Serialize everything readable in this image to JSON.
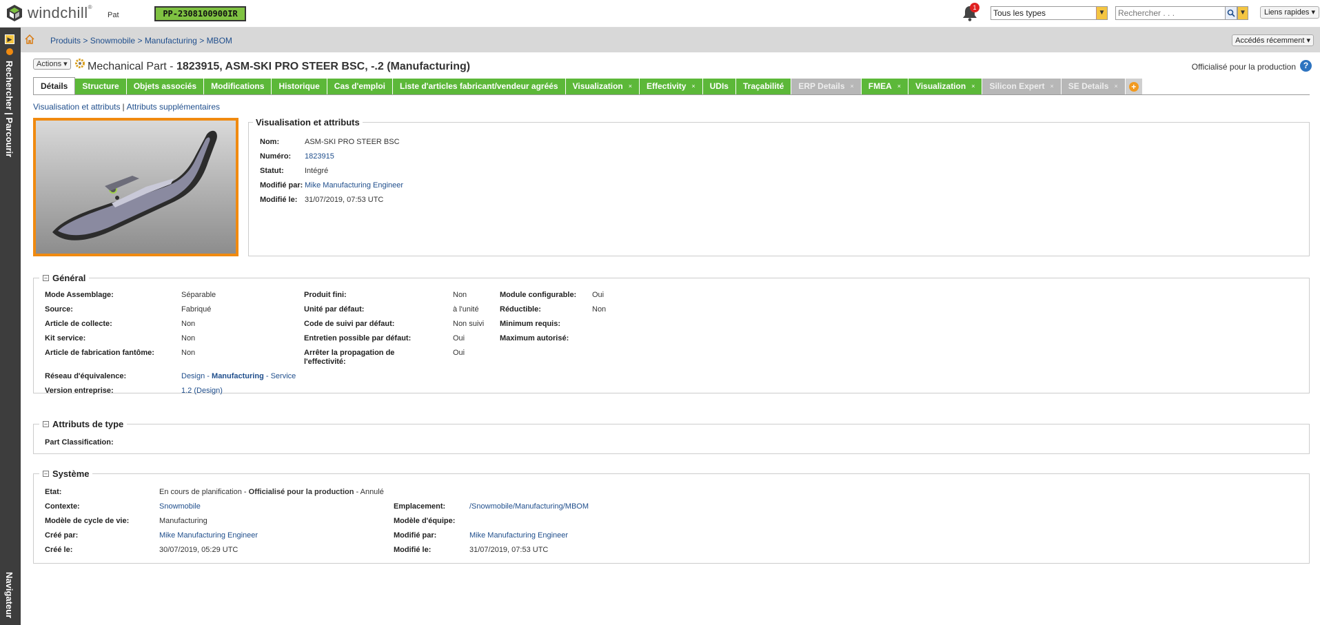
{
  "header": {
    "brand": "windchill",
    "brand_mark": "®",
    "user": "Pat",
    "badge": "PP-2308100900IR",
    "notification_count": "1",
    "type_select": {
      "value": "Tous les types"
    },
    "search": {
      "placeholder": "Rechercher . . ."
    },
    "quick_links": "Liens rapides"
  },
  "leftbar": {
    "search_browse": "Rechercher | Parcourir",
    "navigator": "Navigateur"
  },
  "breadcrumb": {
    "items": [
      "Produits",
      "Snowmobile",
      "Manufacturing",
      "MBOM"
    ],
    "separator": ">"
  },
  "recent": "Accédés récemment",
  "page": {
    "actions_label": "Actions",
    "title_type": "Mechanical Part - ",
    "title_main": "1823915, ASM-SKI PRO STEER BSC, -.2 (Manufacturing)",
    "status_text": "Officialisé pour la production",
    "help": "?"
  },
  "tabs": [
    {
      "label": "Détails"
    },
    {
      "label": "Structure"
    },
    {
      "label": "Objets associés"
    },
    {
      "label": "Modifications"
    },
    {
      "label": "Historique"
    },
    {
      "label": "Cas d'emploi"
    },
    {
      "label": "Liste d'articles fabricant/vendeur agréés"
    },
    {
      "label": "Visualization",
      "close": "×"
    },
    {
      "label": "Effectivity",
      "close": "×"
    },
    {
      "label": "UDIs"
    },
    {
      "label": "Traçabilité"
    },
    {
      "label": "ERP Details",
      "close": "×"
    },
    {
      "label": "FMEA",
      "close": "×"
    },
    {
      "label": "Visualization",
      "close": "×"
    },
    {
      "label": "Silicon Expert",
      "close": "×"
    },
    {
      "label": "SE Details",
      "close": "×"
    }
  ],
  "tab_add": "+",
  "subnav": {
    "item1": "Visualisation et attributs",
    "sep": "|",
    "item2": "Attributs supplémentaires"
  },
  "vis_attrs": {
    "legend": "Visualisation et attributs",
    "rows": [
      {
        "label": "Nom:",
        "value": "ASM-SKI PRO STEER BSC"
      },
      {
        "label": "Numéro:",
        "value": "1823915"
      },
      {
        "label": "Statut:",
        "value": "Intégré"
      },
      {
        "label": "Modifié par:",
        "value": "Mike Manufacturing Engineer"
      },
      {
        "label": "Modifié le:",
        "value": "31/07/2019, 07:53 UTC"
      }
    ]
  },
  "general": {
    "legend": "Général",
    "toggle": "–",
    "col1": [
      {
        "label": "Mode Assemblage:",
        "value": "Séparable"
      },
      {
        "label": "Source:",
        "value": "Fabriqué"
      },
      {
        "label": "Article de collecte:",
        "value": "Non"
      },
      {
        "label": "Kit service:",
        "value": "Non"
      },
      {
        "label": "Article de fabrication fantôme:",
        "value": "Non"
      }
    ],
    "col2": [
      {
        "label": "Produit fini:",
        "value": "Non"
      },
      {
        "label": "Unité par défaut:",
        "value": "à l'unité"
      },
      {
        "label": "Code de suivi par défaut:",
        "value": "Non suivi"
      },
      {
        "label": "Entretien possible par défaut:",
        "value": "Oui"
      },
      {
        "label": "Arrêter la propagation de",
        "label2": "l'effectivité:",
        "value": "Oui"
      }
    ],
    "col3": [
      {
        "label": "Module configurable:",
        "value": "Oui"
      },
      {
        "label": "Réductible:",
        "value": "Non"
      },
      {
        "label": "Minimum requis:",
        "value": ""
      },
      {
        "label": "Maximum autorisé:",
        "value": ""
      }
    ],
    "equivalence": {
      "label": "Réseau d'équivalence:",
      "design": "Design",
      "dash": " - ",
      "manufacturing": "Manufacturing",
      "service": "Service"
    },
    "version": {
      "label": "Version entreprise:",
      "value": "1.2 (Design)"
    }
  },
  "type_attrs": {
    "legend": "Attributs de type",
    "toggle": "–",
    "label": "Part Classification:"
  },
  "system": {
    "legend": "Système",
    "toggle": "–",
    "state": {
      "label": "Etat:",
      "v1": "En cours de planification",
      "dash": " - ",
      "v2": "Officialisé pour la production",
      "v3": "Annulé"
    },
    "left": [
      {
        "label": "Contexte:",
        "value": "Snowmobile"
      },
      {
        "label": "Modèle de cycle de vie:",
        "value": "Manufacturing"
      },
      {
        "label": "Créé par:",
        "value": "Mike Manufacturing Engineer"
      },
      {
        "label": "Créé le:",
        "value": "30/07/2019, 05:29 UTC"
      }
    ],
    "right": [
      {
        "label": "Emplacement:",
        "value": "/Snowmobile/Manufacturing/MBOM"
      },
      {
        "label": "Modèle d'équipe:",
        "value": ""
      },
      {
        "label": "Modifié par:",
        "value": "Mike Manufacturing Engineer"
      },
      {
        "label": "Modifié le:",
        "value": "31/07/2019, 07:53 UTC"
      }
    ]
  }
}
